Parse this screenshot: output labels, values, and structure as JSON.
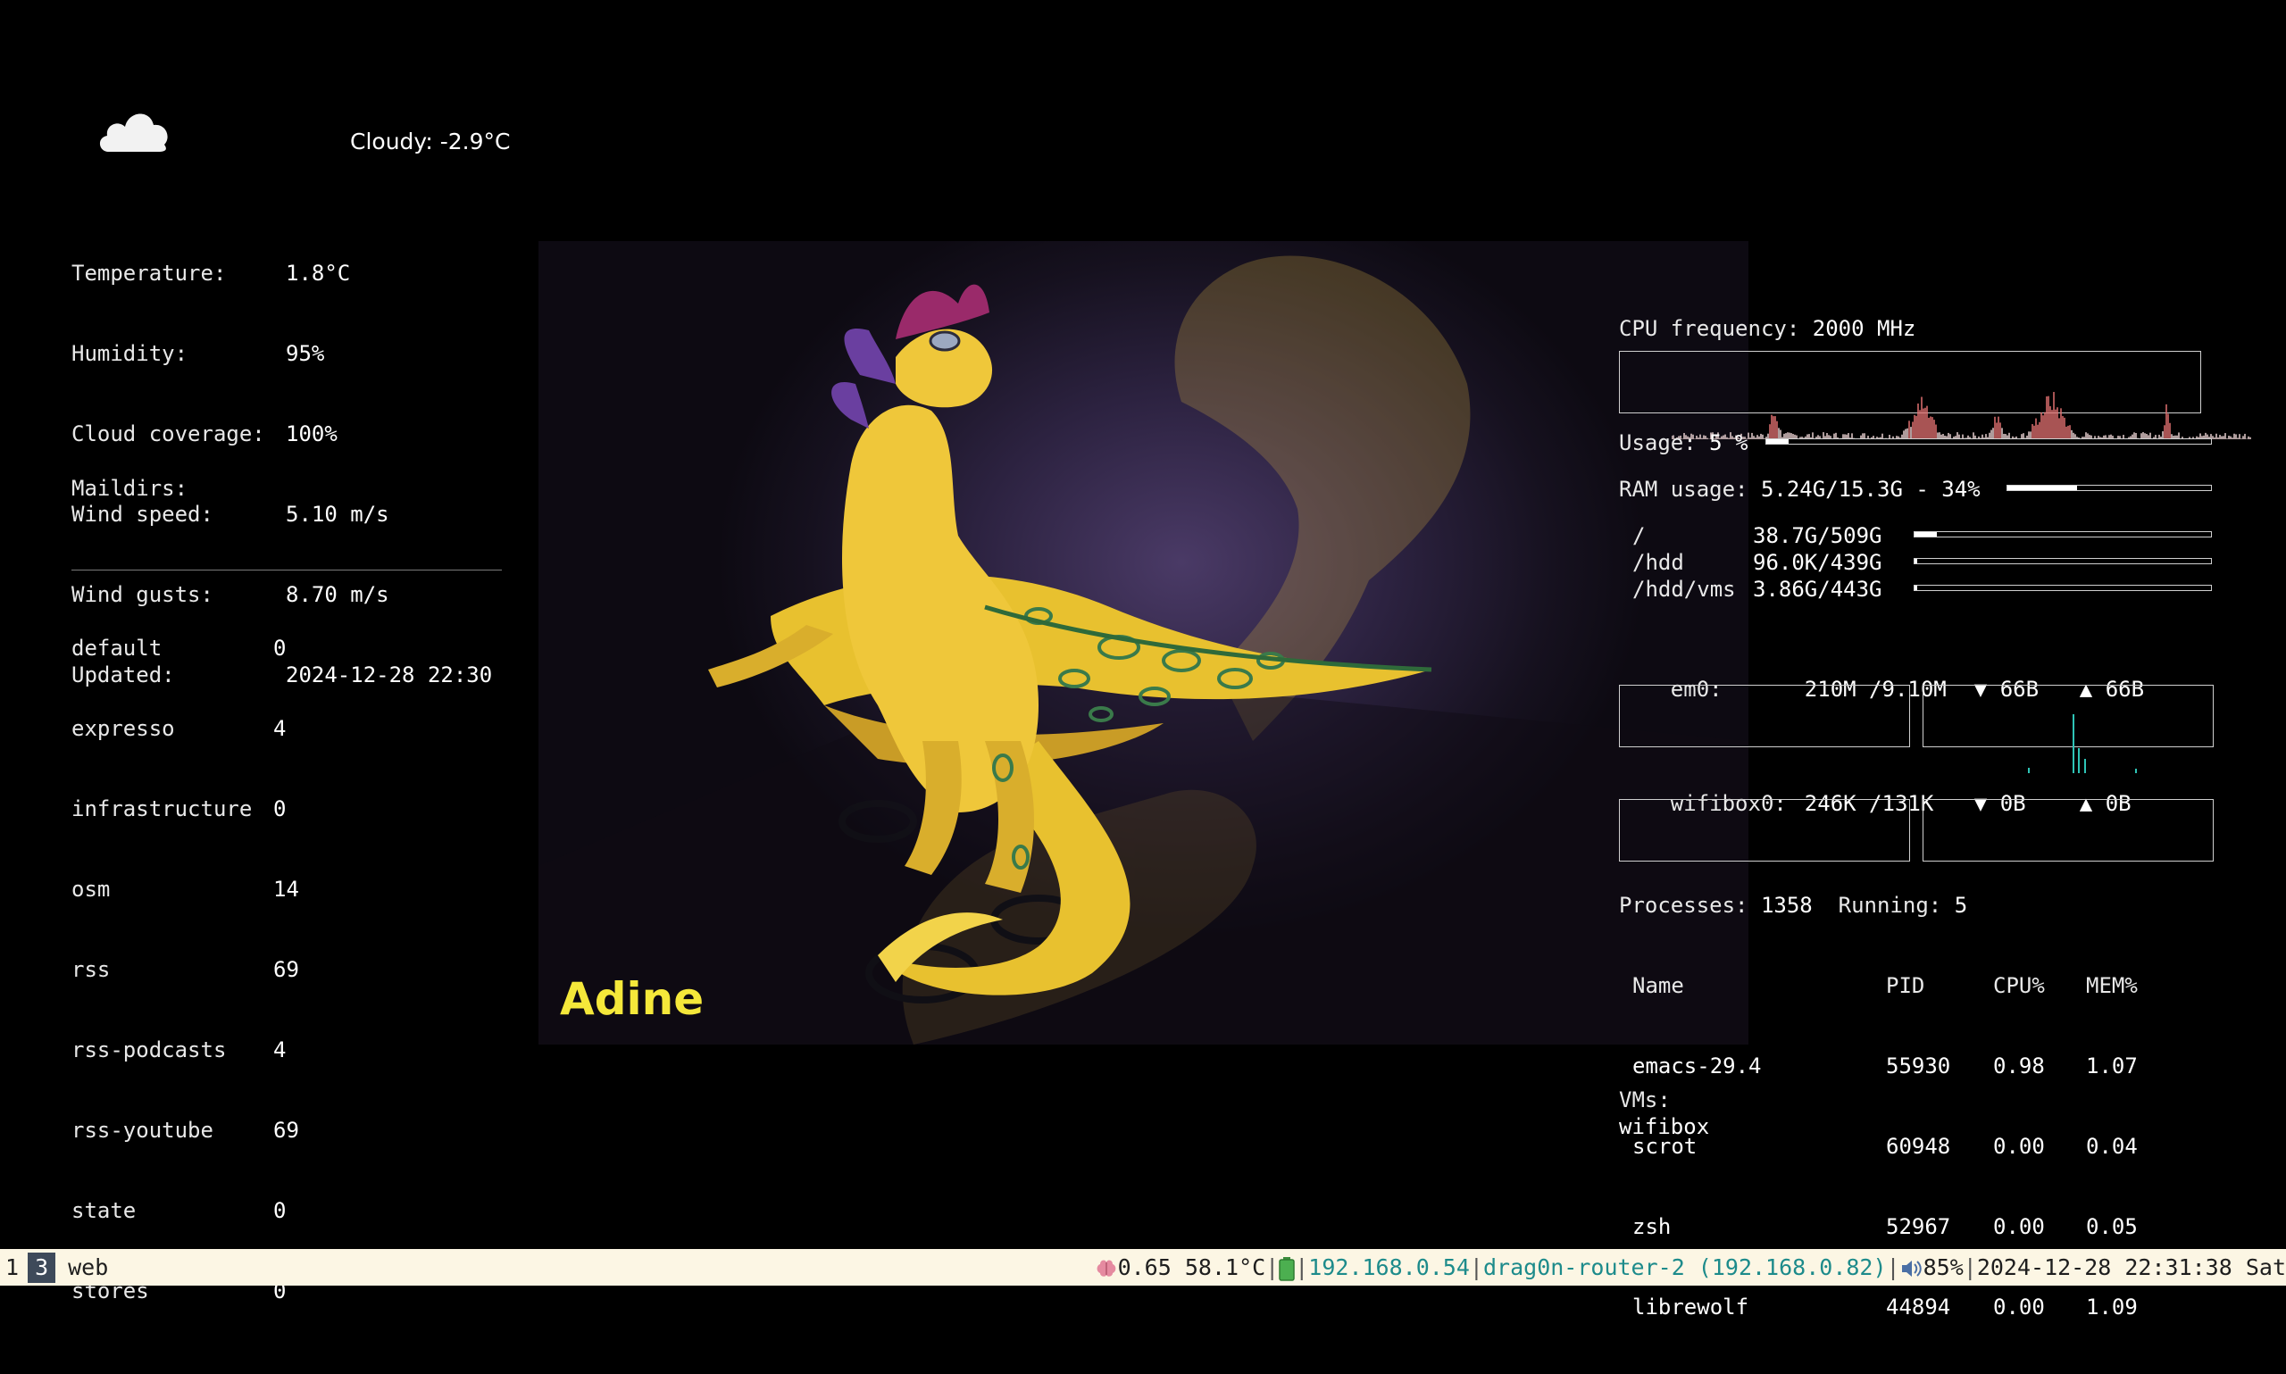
{
  "weather": {
    "icon": "cloud-icon",
    "summary": "Cloudy: -2.9°C",
    "rows": [
      {
        "label": "Temperature:",
        "value": "1.8°C"
      },
      {
        "label": "Humidity:",
        "value": "95%"
      },
      {
        "label": "Cloud coverage:",
        "value": "100%"
      },
      {
        "label": "Wind speed:",
        "value": "5.10 m/s"
      },
      {
        "label": "Wind gusts:",
        "value": "8.70 m/s"
      },
      {
        "label": "Updated:",
        "value": "2024-12-28 22:30"
      }
    ]
  },
  "maildirs": {
    "title": "Maildirs:",
    "items": [
      {
        "name": "default",
        "count": "0"
      },
      {
        "name": "expresso",
        "count": "4"
      },
      {
        "name": "infrastructure",
        "count": "0"
      },
      {
        "name": "osm",
        "count": "14"
      },
      {
        "name": "rss",
        "count": "69"
      },
      {
        "name": "rss-podcasts",
        "count": "4"
      },
      {
        "name": "rss-youtube",
        "count": "69"
      },
      {
        "name": "state",
        "count": "0"
      },
      {
        "name": "stores",
        "count": "0"
      }
    ]
  },
  "wallpaper": {
    "name": "Adine",
    "name_color": "#f5e83a"
  },
  "sysmon": {
    "cpu_freq_label": "CPU frequency:",
    "cpu_freq_value": "2000 MHz",
    "usage_label": "Usage:",
    "usage_value": "5 %",
    "usage_fraction": 0.05,
    "ram_label": "RAM usage:",
    "ram_value": "5.24G/15.3G - 34%",
    "ram_fraction": 0.34,
    "disks": [
      {
        "mount": "/",
        "usage": "38.7G/509G",
        "fraction": 0.076
      },
      {
        "mount": "/hdd",
        "usage": "96.0K/439G",
        "fraction": 0.0
      },
      {
        "mount": "/hdd/vms",
        "usage": "3.86G/443G",
        "fraction": 0.009
      }
    ],
    "net": [
      {
        "iface": "em0:",
        "totals": "210M /9.10M",
        "down": "▼ 66B",
        "up": "▲ 66B"
      },
      {
        "iface": "wifibox0:",
        "totals": "246K /131K",
        "down": "▼ 0B",
        "up": "▲ 0B"
      }
    ],
    "processes_label": "Processes:",
    "processes_value": "1358",
    "running_label": "Running:",
    "running_value": "5",
    "proc_headers": [
      "Name",
      "PID",
      "CPU%",
      "MEM%"
    ],
    "procs": [
      {
        "name": "emacs-29.4",
        "pid": "55930",
        "cpu": "0.98",
        "mem": "1.07"
      },
      {
        "name": "scrot",
        "pid": "60948",
        "cpu": "0.00",
        "mem": "0.04"
      },
      {
        "name": "zsh",
        "pid": "52967",
        "cpu": "0.00",
        "mem": "0.05"
      },
      {
        "name": "librewolf",
        "pid": "44894",
        "cpu": "0.00",
        "mem": "1.09"
      }
    ],
    "vms_label": "VMs:",
    "vms": [
      "wifibox"
    ]
  },
  "statusbar": {
    "workspaces": [
      {
        "label": "1",
        "active": false
      },
      {
        "label": "3",
        "active": true
      }
    ],
    "window_title": "web",
    "load_icon": "brain-icon",
    "load": "0.65",
    "temp": "58.1°C",
    "battery_icon": "battery-icon",
    "ip": "192.168.0.54",
    "wifi": "drag0n-router-2 (192.168.0.82)",
    "volume_icon": "speaker-icon",
    "volume": "85%",
    "datetime": "2024-12-28 22:31:38 Sat"
  }
}
